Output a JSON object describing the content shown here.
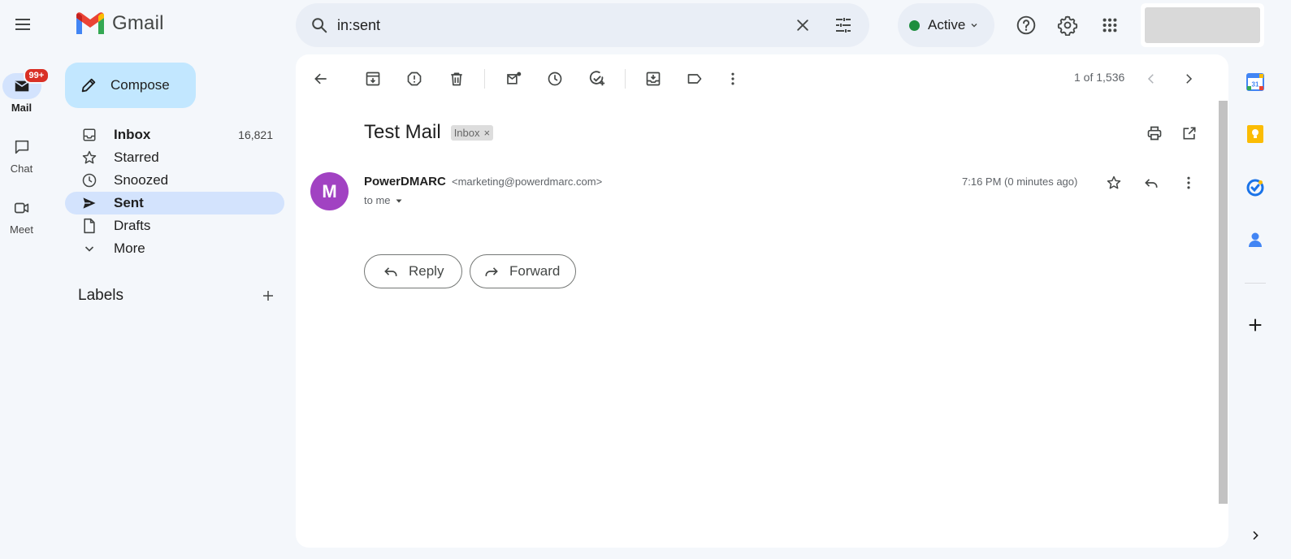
{
  "app": {
    "name": "Gmail"
  },
  "rail": {
    "mail_badge": "99+",
    "items": [
      {
        "label": "Mail"
      },
      {
        "label": "Chat"
      },
      {
        "label": "Meet"
      }
    ]
  },
  "search": {
    "value": "in:sent"
  },
  "status": {
    "label": "Active",
    "color": "#1e8e3e"
  },
  "compose": {
    "label": "Compose"
  },
  "nav": {
    "items": [
      {
        "label": "Inbox",
        "count": "16,821"
      },
      {
        "label": "Starred"
      },
      {
        "label": "Snoozed"
      },
      {
        "label": "Sent"
      },
      {
        "label": "Drafts"
      },
      {
        "label": "More"
      }
    ]
  },
  "labels": {
    "title": "Labels"
  },
  "pager": {
    "text": "1 of 1,536"
  },
  "message": {
    "subject": "Test Mail",
    "label_chip": "Inbox",
    "label_chip_close": "×",
    "avatar_letter": "M",
    "avatar_color": "#a142c2",
    "sender_name": "PowerDMARC",
    "sender_email": "<marketing@powerdmarc.com>",
    "recipients": "to me",
    "timestamp": "7:16 PM (0 minutes ago)"
  },
  "actions": {
    "reply": "Reply",
    "forward": "Forward"
  },
  "colors": {
    "accent": "#c2e7ff",
    "active_nav": "#d3e3fd",
    "badge": "#d93025"
  },
  "icons": {
    "toolbar": [
      "back-arrow-icon",
      "archive-icon",
      "report-spam-icon",
      "delete-icon",
      "mark-unread-icon",
      "snooze-icon",
      "add-task-icon",
      "move-to-icon",
      "label-icon",
      "more-vert-icon"
    ],
    "side": [
      "calendar-icon",
      "keep-icon",
      "tasks-icon",
      "contacts-icon"
    ]
  }
}
